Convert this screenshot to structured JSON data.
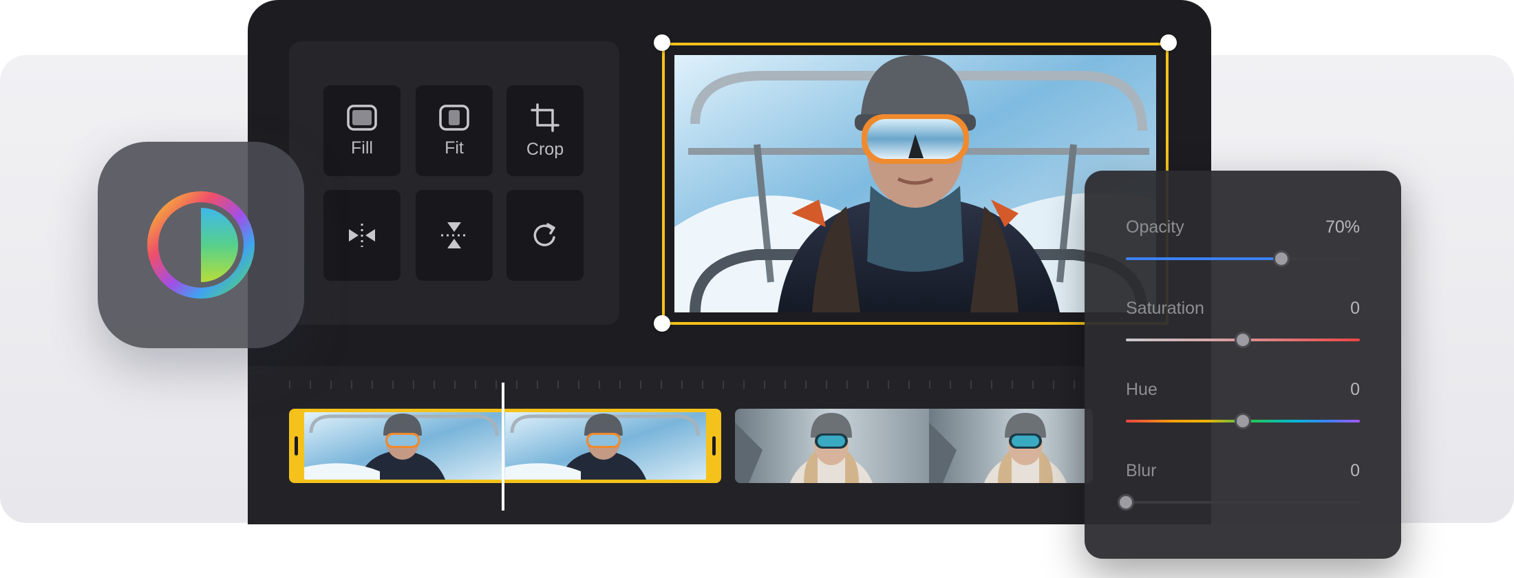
{
  "tools": {
    "fill_label": "Fill",
    "fit_label": "Fit",
    "crop_label": "Crop",
    "icons": [
      "fill-icon",
      "fit-icon",
      "crop-icon",
      "flip-horizontal-icon",
      "flip-vertical-icon",
      "rotate-icon"
    ]
  },
  "app_icon": "color-contrast-ring-icon",
  "preview": {
    "selected": true,
    "accent_color": "#f5c21b"
  },
  "timeline": {
    "clips": [
      {
        "selected": true,
        "frames": 2
      },
      {
        "selected": false,
        "frames": 2
      }
    ]
  },
  "adjustments": {
    "opacity": {
      "label": "Opacity",
      "value": "70%",
      "level": 0.66
    },
    "saturation": {
      "label": "Saturation",
      "value": "0",
      "level": 0.5
    },
    "hue": {
      "label": "Hue",
      "value": "0",
      "level": 0.5
    },
    "blur": {
      "label": "Blur",
      "value": "0",
      "level": 0.0
    }
  },
  "colors": {
    "accent_yellow": "#f5c21b",
    "opacity_track": "#3b82f6",
    "saturation_track": "#ef4444"
  }
}
